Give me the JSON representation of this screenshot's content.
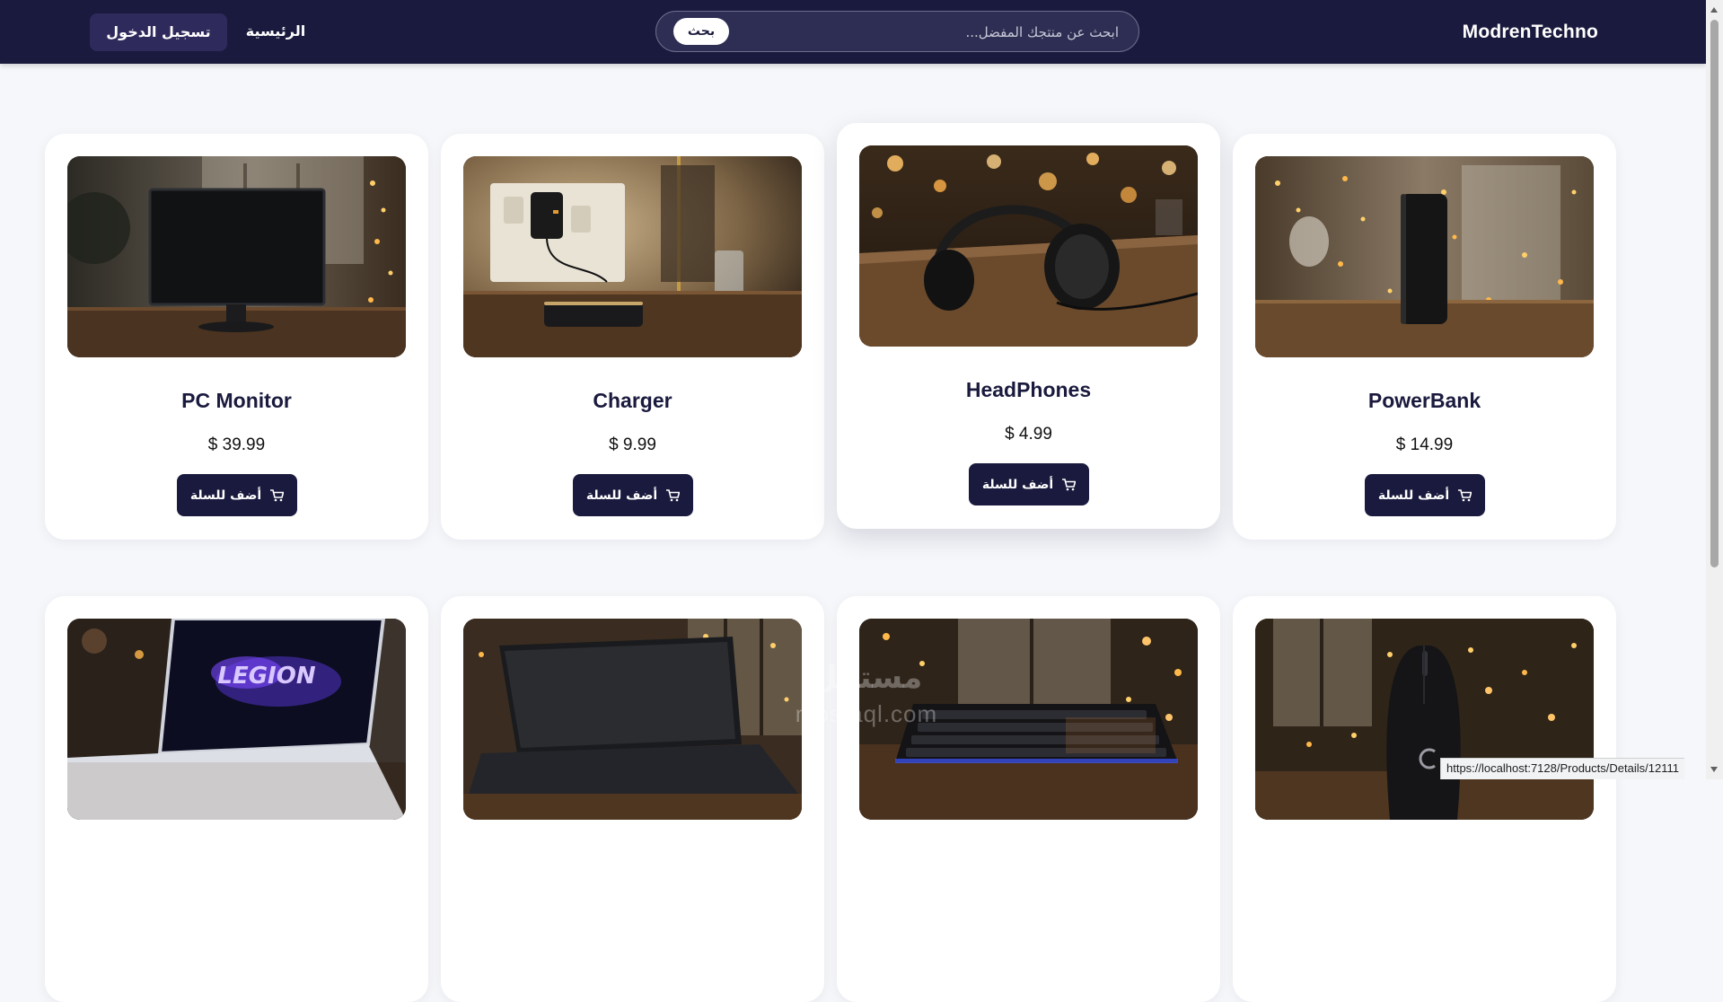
{
  "navbar": {
    "brand": "ModrenTechno",
    "search_placeholder": "ابحث عن منتجك المفضل...",
    "search_button": "بحث",
    "home": "الرئيسية",
    "login": "تسجيل الدخول"
  },
  "products": [
    {
      "name": "PC Monitor",
      "price": "$ 39.99",
      "button": "أضف للسلة",
      "image": "monitor"
    },
    {
      "name": "Charger",
      "price": "$ 9.99",
      "button": "أضف للسلة",
      "image": "charger"
    },
    {
      "name": "HeadPhones",
      "price": "$ 4.99",
      "button": "أضف للسلة",
      "image": "headphones"
    },
    {
      "name": "PowerBank",
      "price": "$ 14.99",
      "button": "أضف للسلة",
      "image": "powerbank"
    },
    {
      "image": "gaming-laptop",
      "screen_text": "LEGION"
    },
    {
      "image": "laptop"
    },
    {
      "image": "keyboard"
    },
    {
      "image": "mouse"
    }
  ],
  "watermark": {
    "arabic": "مستقل",
    "latin": "mostaql.com"
  },
  "status_bar": {
    "url": "https://localhost:7128/Products/Details/12111"
  },
  "colors": {
    "navy": "#1a1a3e",
    "background": "#f6f7fa",
    "card": "#ffffff"
  }
}
